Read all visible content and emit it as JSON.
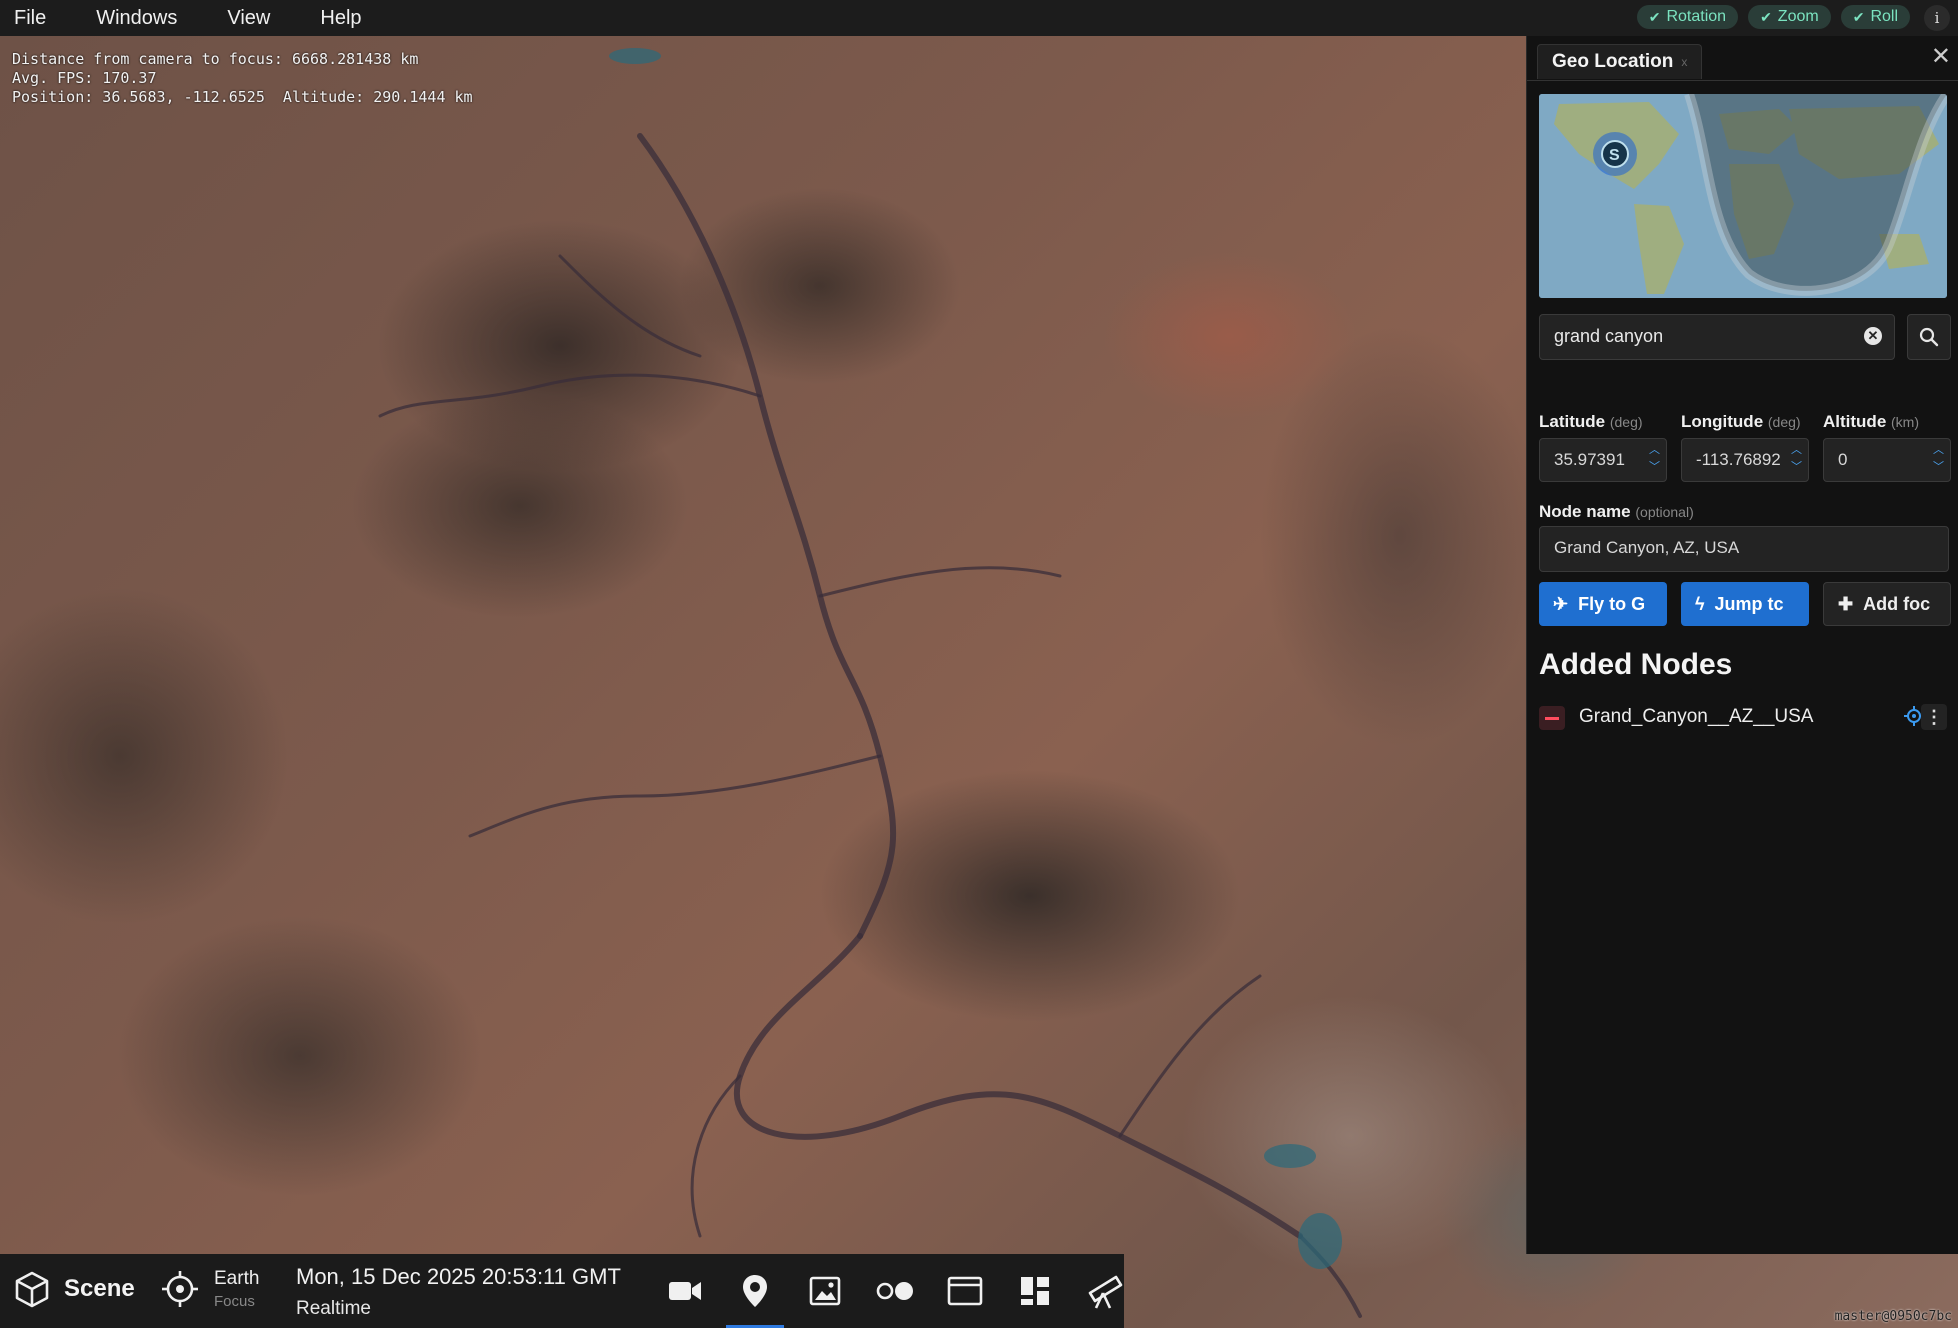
{
  "menu": {
    "items": [
      "File",
      "Windows",
      "View",
      "Help"
    ]
  },
  "toggles": [
    {
      "label": "Rotation"
    },
    {
      "label": "Zoom"
    },
    {
      "label": "Roll"
    }
  ],
  "info_icon": "i",
  "stats": {
    "distance": "Distance from camera to focus: 6668.281438 km",
    "fps": "Avg. FPS: 170.37",
    "position": "Position: 36.5683, -112.6525  Altitude: 290.1444 km"
  },
  "panel": {
    "tab_title": "Geo Location",
    "tab_close": "x",
    "search_value": "grand canyon",
    "latitude": {
      "label": "Latitude",
      "unit": "(deg)",
      "value": "35.97391"
    },
    "longitude": {
      "label": "Longitude",
      "unit": "(deg)",
      "value": "-113.76892"
    },
    "altitude": {
      "label": "Altitude",
      "unit": "(km)",
      "value": "0"
    },
    "node_name": {
      "label": "Node name",
      "hint": "(optional)",
      "value": "Grand Canyon, AZ, USA"
    },
    "buttons": {
      "fly": "Fly to G",
      "jump": "Jump tc",
      "add": "Add foc"
    },
    "added_nodes_title": "Added Nodes",
    "added_nodes": [
      {
        "name": "Grand_Canyon__AZ__USA"
      }
    ]
  },
  "bottombar": {
    "scene_label": "Scene",
    "focus_name": "Earth",
    "focus_label": "Focus",
    "datetime": "Mon, 15 Dec 2025 20:53:11 GMT",
    "time_mode": "Realtime"
  },
  "version": "master@0950c7bc",
  "colors": {
    "accent": "#1f6fd0",
    "toggle_text": "#7be3c0",
    "remove": "#ff4d5e"
  }
}
